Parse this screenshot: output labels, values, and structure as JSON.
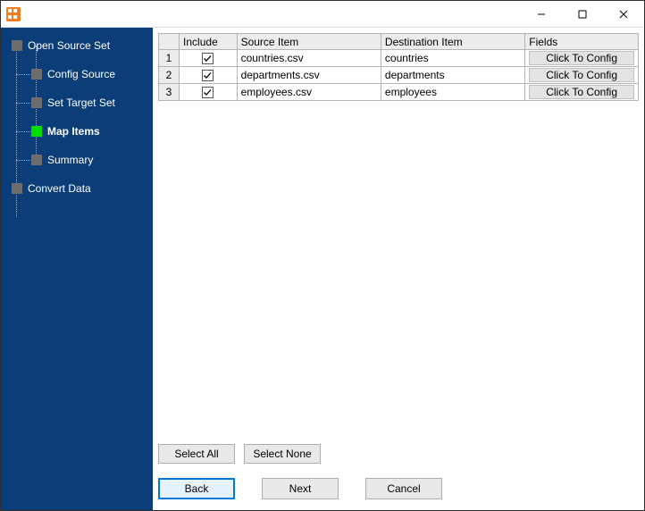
{
  "sidebar": {
    "items": [
      {
        "label": "Open Source Set",
        "level": 0
      },
      {
        "label": "Config Source",
        "level": 1
      },
      {
        "label": "Set Target Set",
        "level": 1
      },
      {
        "label": "Map Items",
        "level": 1,
        "active": true
      },
      {
        "label": "Summary",
        "level": 1
      },
      {
        "label": "Convert Data",
        "level": 0
      }
    ]
  },
  "grid": {
    "headers": {
      "include": "Include",
      "source": "Source Item",
      "dest": "Destination Item",
      "fields": "Fields"
    },
    "config_button_label": "Click To Config",
    "rows": [
      {
        "n": "1",
        "include": true,
        "source": "countries.csv",
        "dest": "countries"
      },
      {
        "n": "2",
        "include": true,
        "source": "departments.csv",
        "dest": "departments"
      },
      {
        "n": "3",
        "include": true,
        "source": "employees.csv",
        "dest": "employees"
      }
    ]
  },
  "selection": {
    "select_all": "Select All",
    "select_none": "Select None"
  },
  "wizard": {
    "back": "Back",
    "next": "Next",
    "cancel": "Cancel"
  }
}
